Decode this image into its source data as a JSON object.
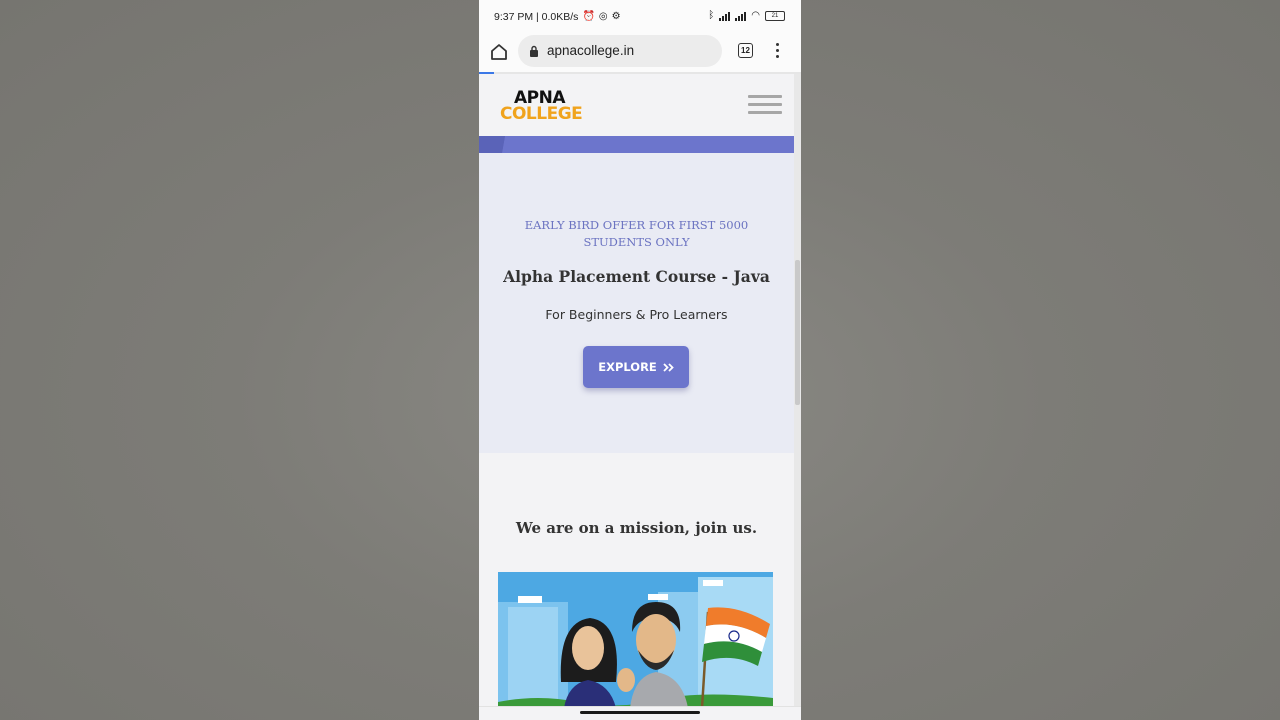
{
  "status_bar": {
    "time_speed": "9:37 PM | 0.0KB/s",
    "battery": "21"
  },
  "browser": {
    "url": "apnacollege.in",
    "tab_count": "12"
  },
  "site": {
    "logo_top": "APNA",
    "logo_bottom": "COLLEGE"
  },
  "hero": {
    "offer_line1": "EARLY BIRD OFFER FOR FIRST 5000",
    "offer_line2": "STUDENTS ONLY",
    "title": "Alpha Placement Course - Java",
    "subtitle": "For Beginners & Pro Learners",
    "button_label": "EXPLORE",
    "button_icon": "double-chevron-right-icon"
  },
  "mission": {
    "title": "We are on a mission, join us."
  },
  "colors": {
    "accent": "#6c75cc",
    "logo_orange": "#f0a31d",
    "hero_bg": "#e9ebf4"
  }
}
